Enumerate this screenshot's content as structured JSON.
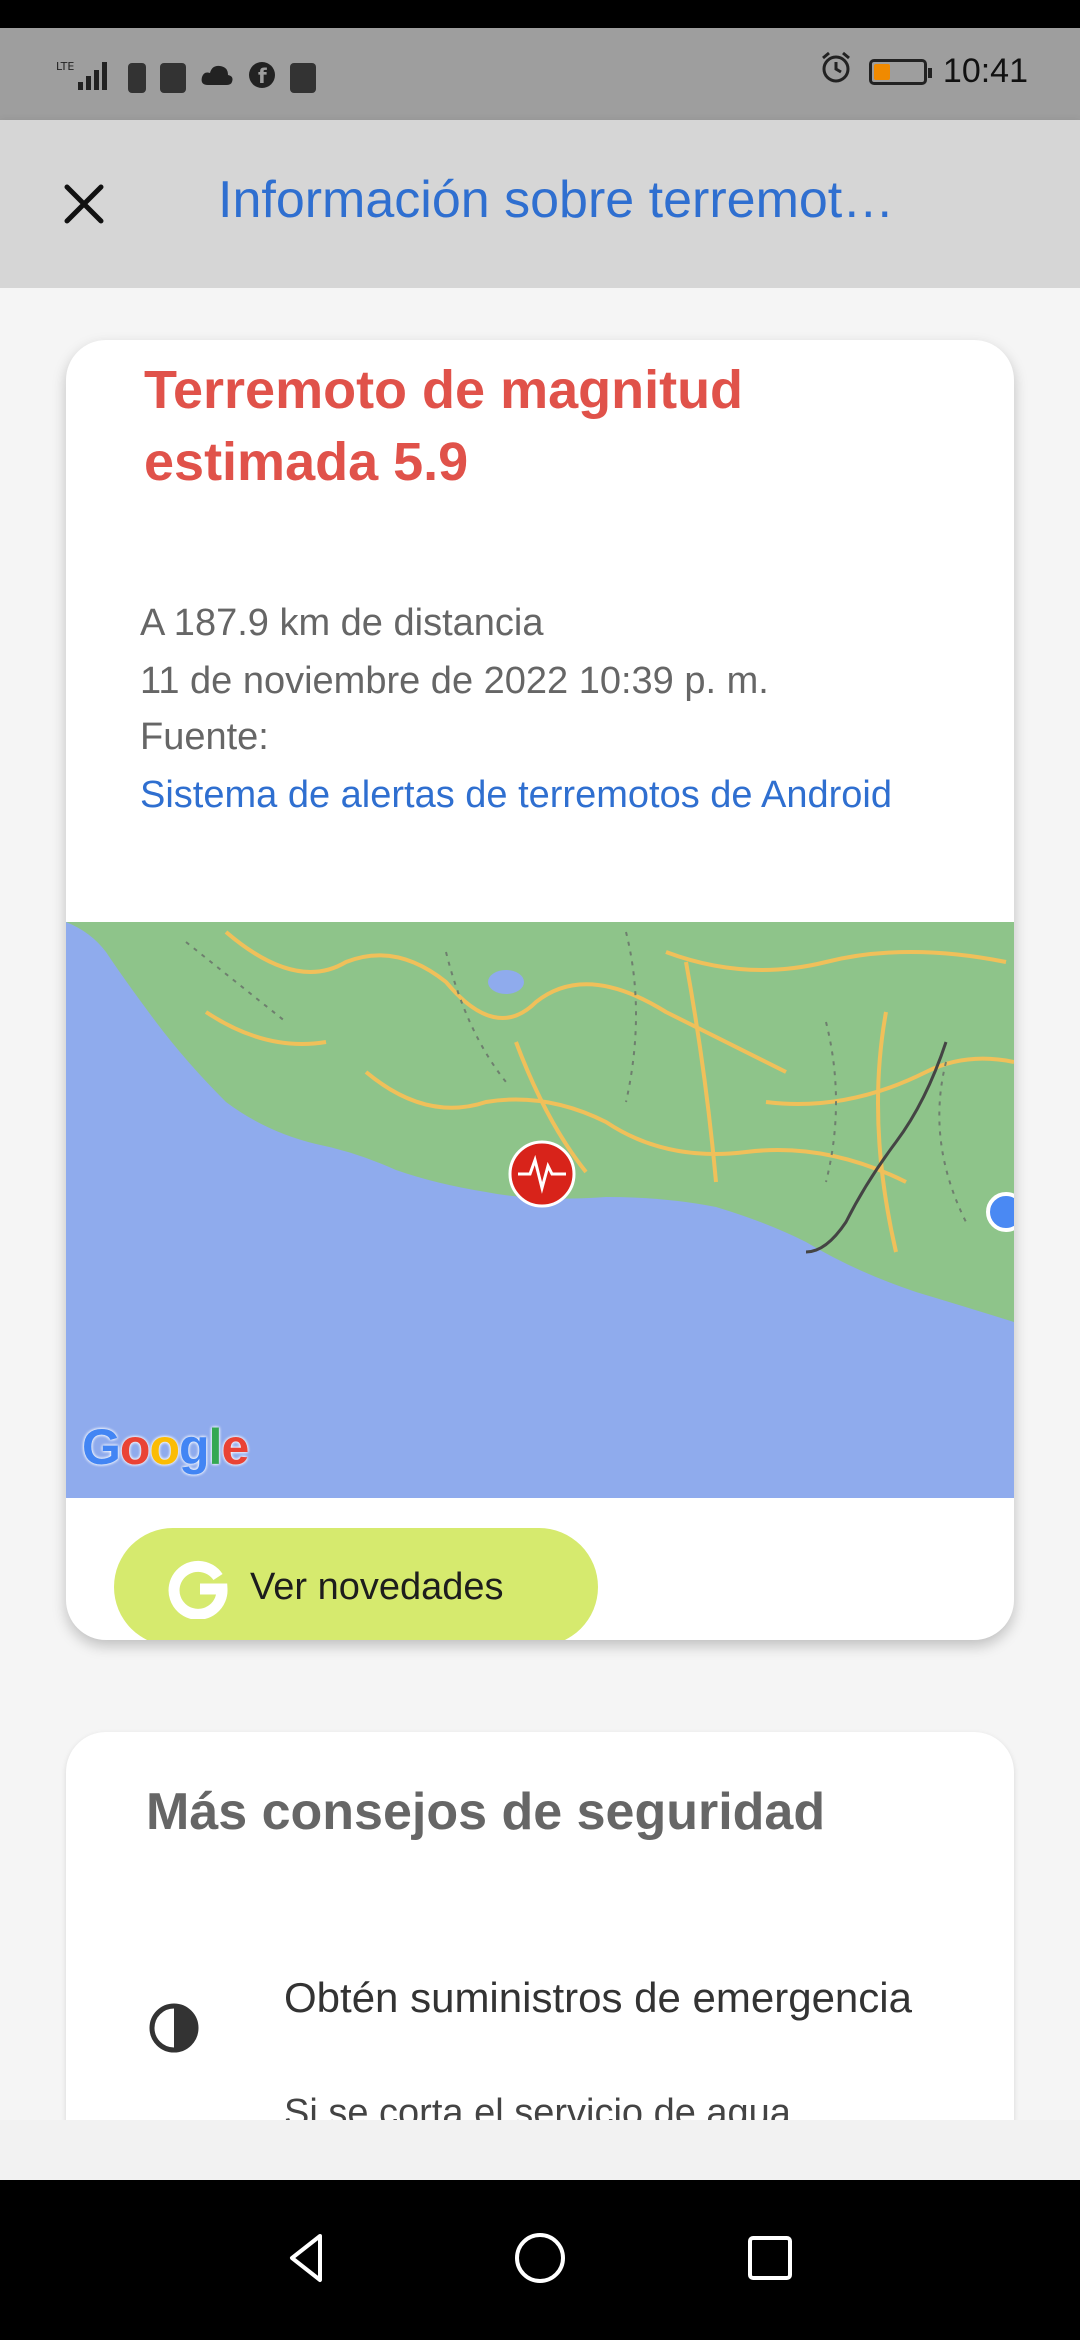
{
  "status_bar": {
    "time": "10:41",
    "icons": [
      "lte-signal-icon",
      "battery-saver-icon",
      "app-icon",
      "cloud-icon",
      "facebook-icon",
      "message-icon",
      "alarm-icon",
      "battery-icon"
    ]
  },
  "app_bar": {
    "title": "Información sobre terremot…",
    "close_icon": "close-icon"
  },
  "alert_card": {
    "title": "Terremoto de magnitud estimada 5.9",
    "distance": "A 187.9 km de distancia",
    "datetime": "11 de noviembre de 2022 10:39 p. m.",
    "source_label": "Fuente:",
    "source_link": "Sistema de alertas de terremotos de Android",
    "map": {
      "logo": "Google",
      "marker_icon": "earthquake-marker-icon",
      "colors": {
        "water": "#8fabed",
        "land": "#8ec48a",
        "roads": "#f0c05a",
        "marker": "#d8231a"
      }
    },
    "button": {
      "label": "Ver novedades",
      "icon": "google-g-icon",
      "color": "#d6ea6e"
    }
  },
  "tips_card": {
    "title": "Más consejos de seguridad",
    "tips": [
      {
        "icon": "half-circle-icon",
        "title": "Obtén suministros de emergencia",
        "desc": "Si se corta el servicio de agua,"
      }
    ]
  },
  "nav_bar": {
    "back": "back-icon",
    "home": "home-icon",
    "recents": "recents-icon"
  }
}
